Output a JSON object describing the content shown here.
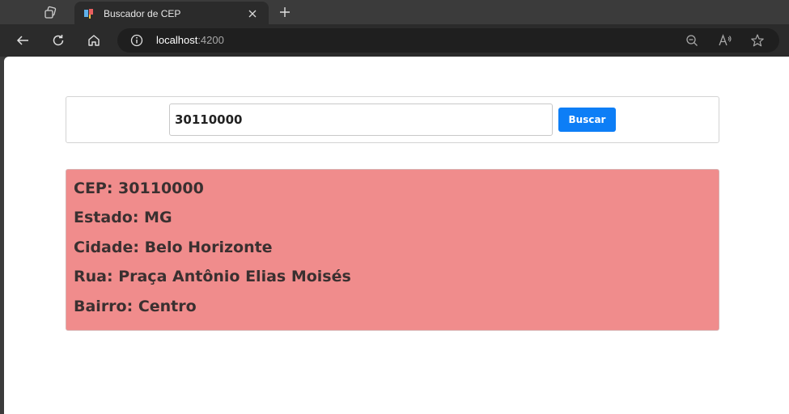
{
  "browser": {
    "tab": {
      "title": "Buscador de CEP"
    },
    "address": {
      "host": "localhost",
      "port": ":4200"
    }
  },
  "search": {
    "input_value": "30110000",
    "button_label": "Buscar"
  },
  "result": {
    "lines": [
      "CEP: 30110000",
      "Estado: MG",
      "Cidade: Belo Horizonte",
      "Rua: Praça Antônio Elias Moisés",
      "Bairro: Centro"
    ]
  },
  "colors": {
    "primary_button": "#0d7ef6",
    "result_background": "#f08c8c"
  }
}
